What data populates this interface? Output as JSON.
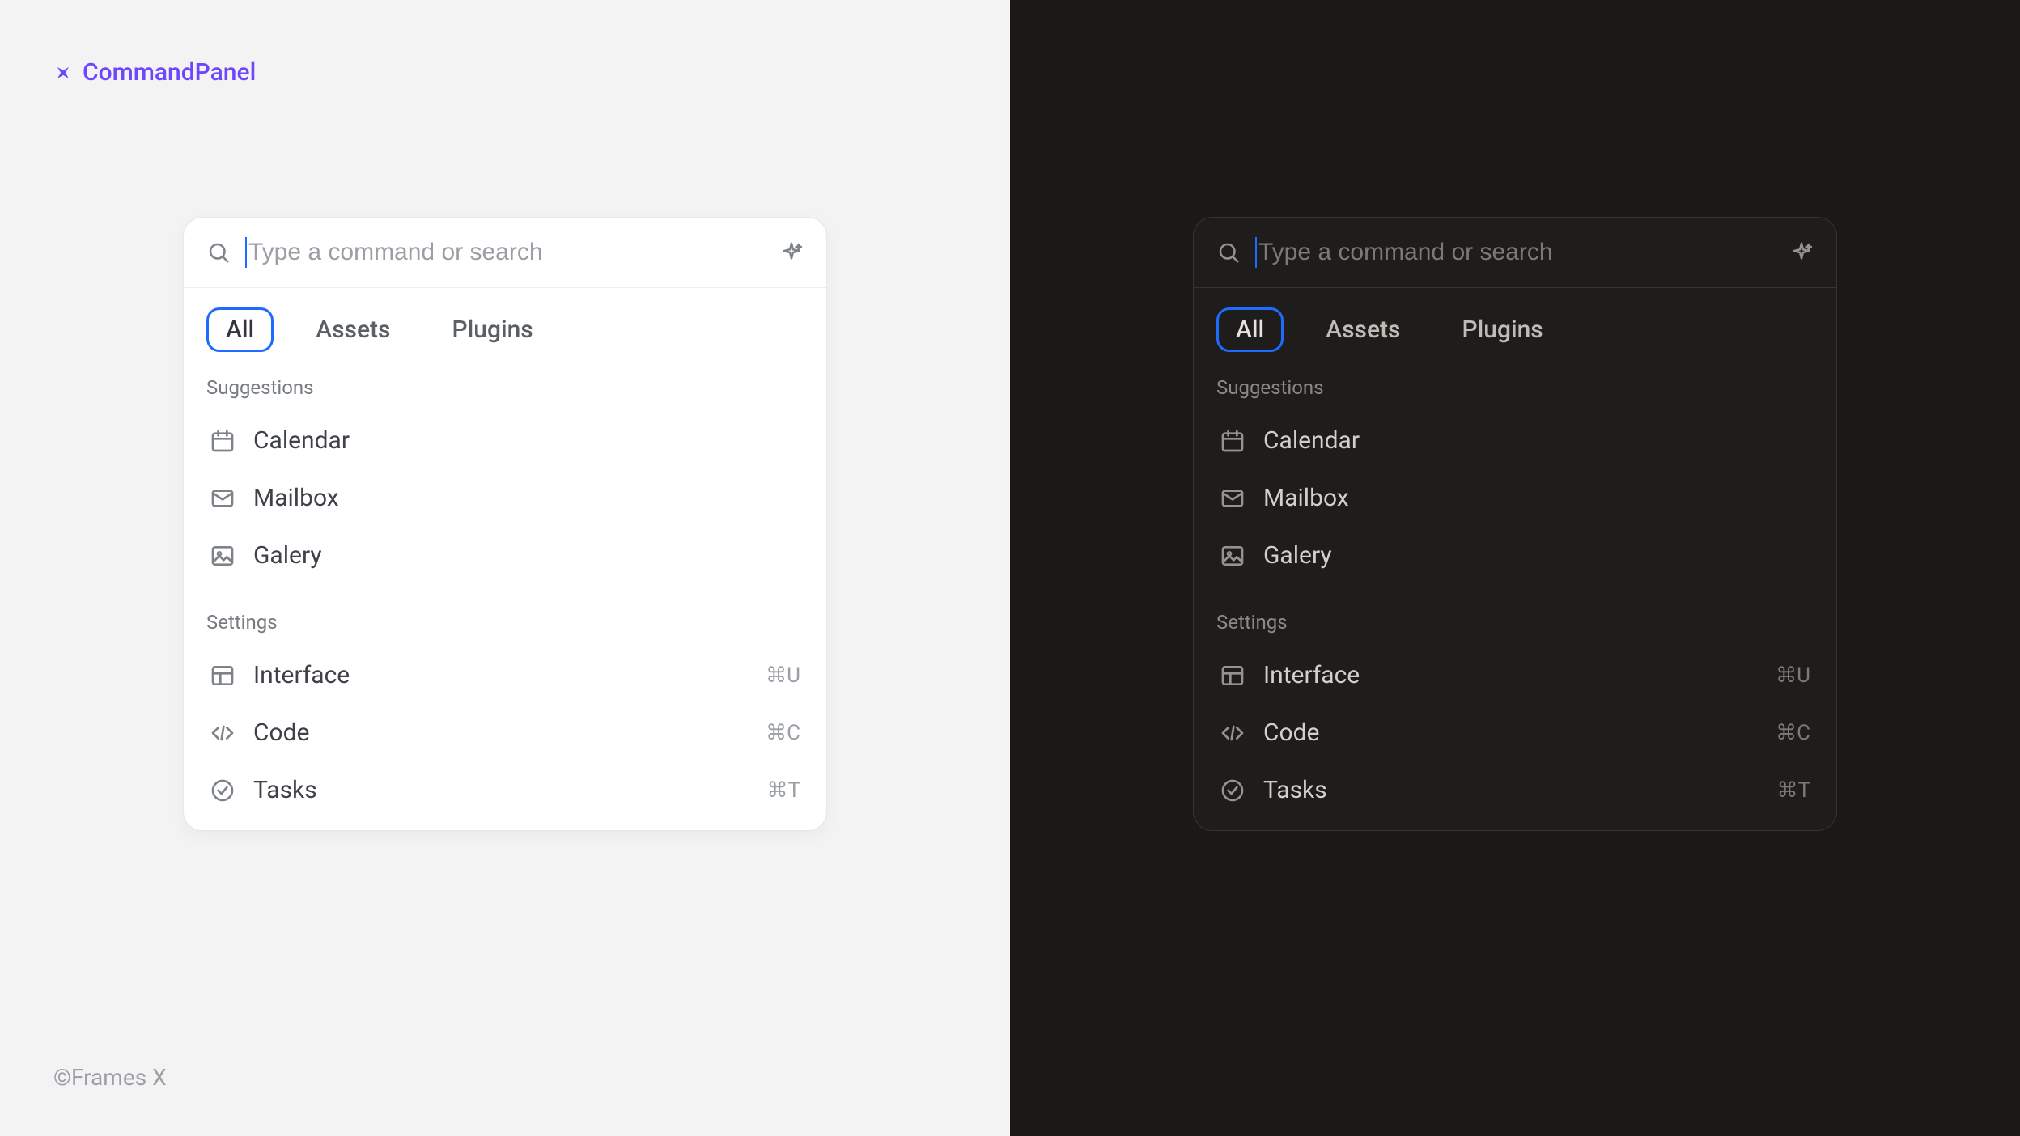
{
  "component_name": "CommandPanel",
  "footer": "©Frames X",
  "search": {
    "placeholder": "Type a command or search"
  },
  "tabs": [
    {
      "label": "All",
      "active": true
    },
    {
      "label": "Assets",
      "active": false
    },
    {
      "label": "Plugins",
      "active": false
    }
  ],
  "sections": [
    {
      "title": "Suggestions",
      "items": [
        {
          "icon": "calendar-icon",
          "label": "Calendar",
          "shortcut": ""
        },
        {
          "icon": "mail-icon",
          "label": "Mailbox",
          "shortcut": ""
        },
        {
          "icon": "image-icon",
          "label": "Galery",
          "shortcut": ""
        }
      ]
    },
    {
      "title": "Settings",
      "items": [
        {
          "icon": "layout-icon",
          "label": "Interface",
          "shortcut": "⌘U"
        },
        {
          "icon": "code-icon",
          "label": "Code",
          "shortcut": "⌘C"
        },
        {
          "icon": "check-icon",
          "label": "Tasks",
          "shortcut": "⌘T"
        }
      ]
    }
  ]
}
